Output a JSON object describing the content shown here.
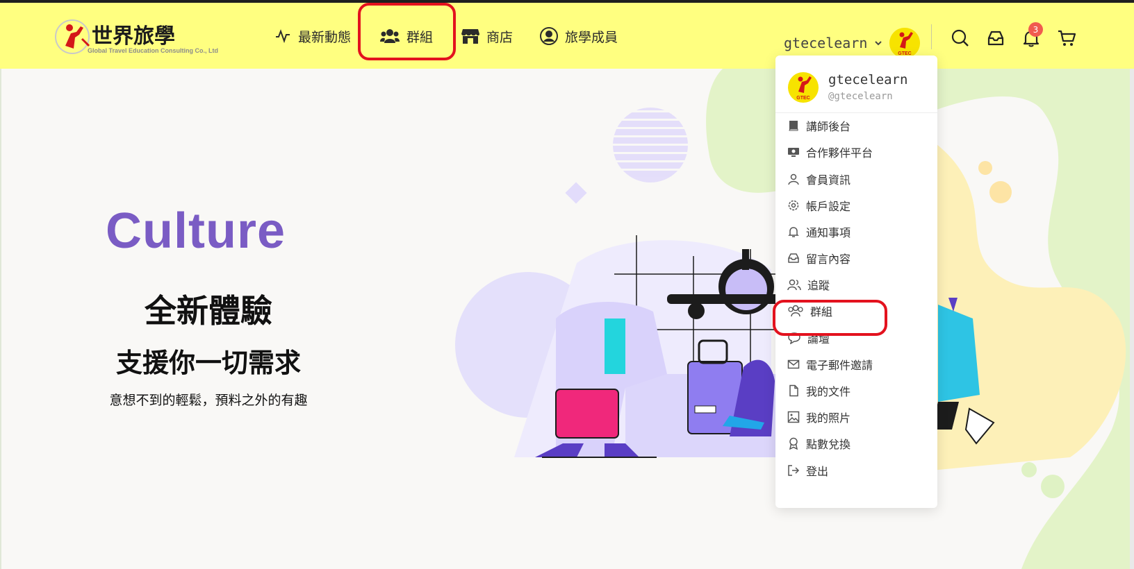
{
  "header": {
    "logo_text": "世界旅學",
    "logo_subtext": "Global Travel Education Consulting Co., Ltd",
    "nav": [
      {
        "label": "最新動態",
        "icon": "activity-icon"
      },
      {
        "label": "群組",
        "icon": "group-icon"
      },
      {
        "label": "商店",
        "icon": "store-icon"
      },
      {
        "label": "旅學成員",
        "icon": "user-circle-icon"
      }
    ],
    "username": "gtecelearn",
    "avatar_text": "GTEC",
    "notification_count": "3"
  },
  "hero": {
    "title": "Culture",
    "subtitle1": "全新體驗",
    "subtitle2": "支援你一切需求",
    "tagline": "意想不到的輕鬆，預料之外的有趣"
  },
  "dropdown": {
    "name": "gtecelearn",
    "handle": "@gtecelearn",
    "items": [
      {
        "label": "講師後台",
        "icon": "book-icon"
      },
      {
        "label": "合作夥伴平台",
        "icon": "partner-icon"
      },
      {
        "label": "會員資訊",
        "icon": "user-icon"
      },
      {
        "label": "帳戶設定",
        "icon": "gear-icon"
      },
      {
        "label": "通知事項",
        "icon": "bell-icon"
      },
      {
        "label": "留言內容",
        "icon": "inbox-icon"
      },
      {
        "label": "追蹤",
        "icon": "users-icon"
      },
      {
        "label": "群組",
        "icon": "group-icon"
      },
      {
        "label": "論壇",
        "icon": "chat-icon"
      },
      {
        "label": "電子郵件邀請",
        "icon": "mail-icon"
      },
      {
        "label": "我的文件",
        "icon": "file-icon"
      },
      {
        "label": "我的照片",
        "icon": "image-icon"
      },
      {
        "label": "點數兌換",
        "icon": "award-icon"
      },
      {
        "label": "登出",
        "icon": "logout-icon"
      }
    ]
  },
  "colors": {
    "header_bg": "#ffff80",
    "accent_purple": "#7a5cc4",
    "highlight_red": "#e3121e",
    "badge": "#f05b4f"
  }
}
